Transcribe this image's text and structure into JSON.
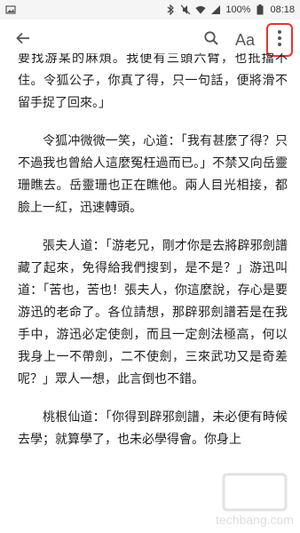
{
  "status_bar": {
    "battery_percent": "100%",
    "time": "08:18",
    "icons": [
      "image-icon",
      "bluetooth-icon",
      "silent-icon",
      "wifi-icon",
      "signal-icon",
      "battery-icon"
    ]
  },
  "app_bar": {
    "back_icon": "arrow-left-icon",
    "search_icon": "search-icon",
    "text_size_label": "Aa",
    "more_icon": "more-vertical-icon",
    "highlight_color": "#e3342f"
  },
  "content": {
    "paragraphs": [
      "要找游某的麻煩。我便有三頭六臂，也抵擋不住。令狐公子，你真了得，只一句話，便將滑不留手捉了回來。」",
      "令狐冲微微一笑，心道：「我有甚麼了得？只不過我也曾給人這麼冤枉過而已。」不禁又向岳靈珊瞧去。岳靈珊也正在瞧他。兩人目光相接，都臉上一紅，迅速轉頭。",
      "張夫人道：「游老兄，剛才你是去將辟邪劍譜藏了起來，免得給我們搜到，是不是？」游迅叫道：「苦也，苦也！張夫人，你這麼說，存心是要游迅的老命了。各位請想，那辟邪劍譜若是在我手中，游迅必定使劍，而且一定劍法極高，何以我身上一不帶劍，二不使劍，三來武功又是奇差呢？」眾人一想，此言倒也不錯。",
      "桃根仙道：「你得到辟邪劍譜，未必便有時候去學；就算學了，也未必學得會。你身上"
    ]
  },
  "watermark": {
    "text": "techbang.com"
  }
}
